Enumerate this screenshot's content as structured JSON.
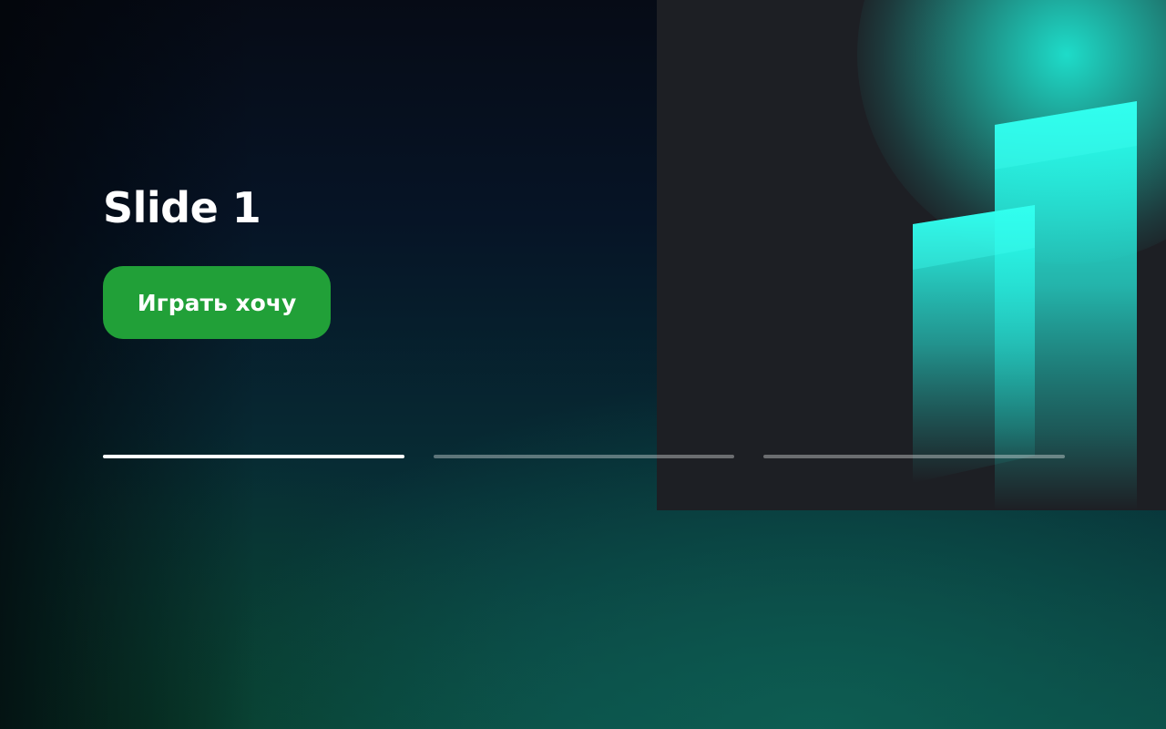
{
  "slide": {
    "title": "Slide 1",
    "cta_label": "Играть хочу"
  },
  "pager": {
    "count": 3,
    "active_index": 0
  },
  "colors": {
    "cta_background": "#21a038",
    "accent_cyan": "#2affee",
    "panel_background": "#1d1f24"
  }
}
